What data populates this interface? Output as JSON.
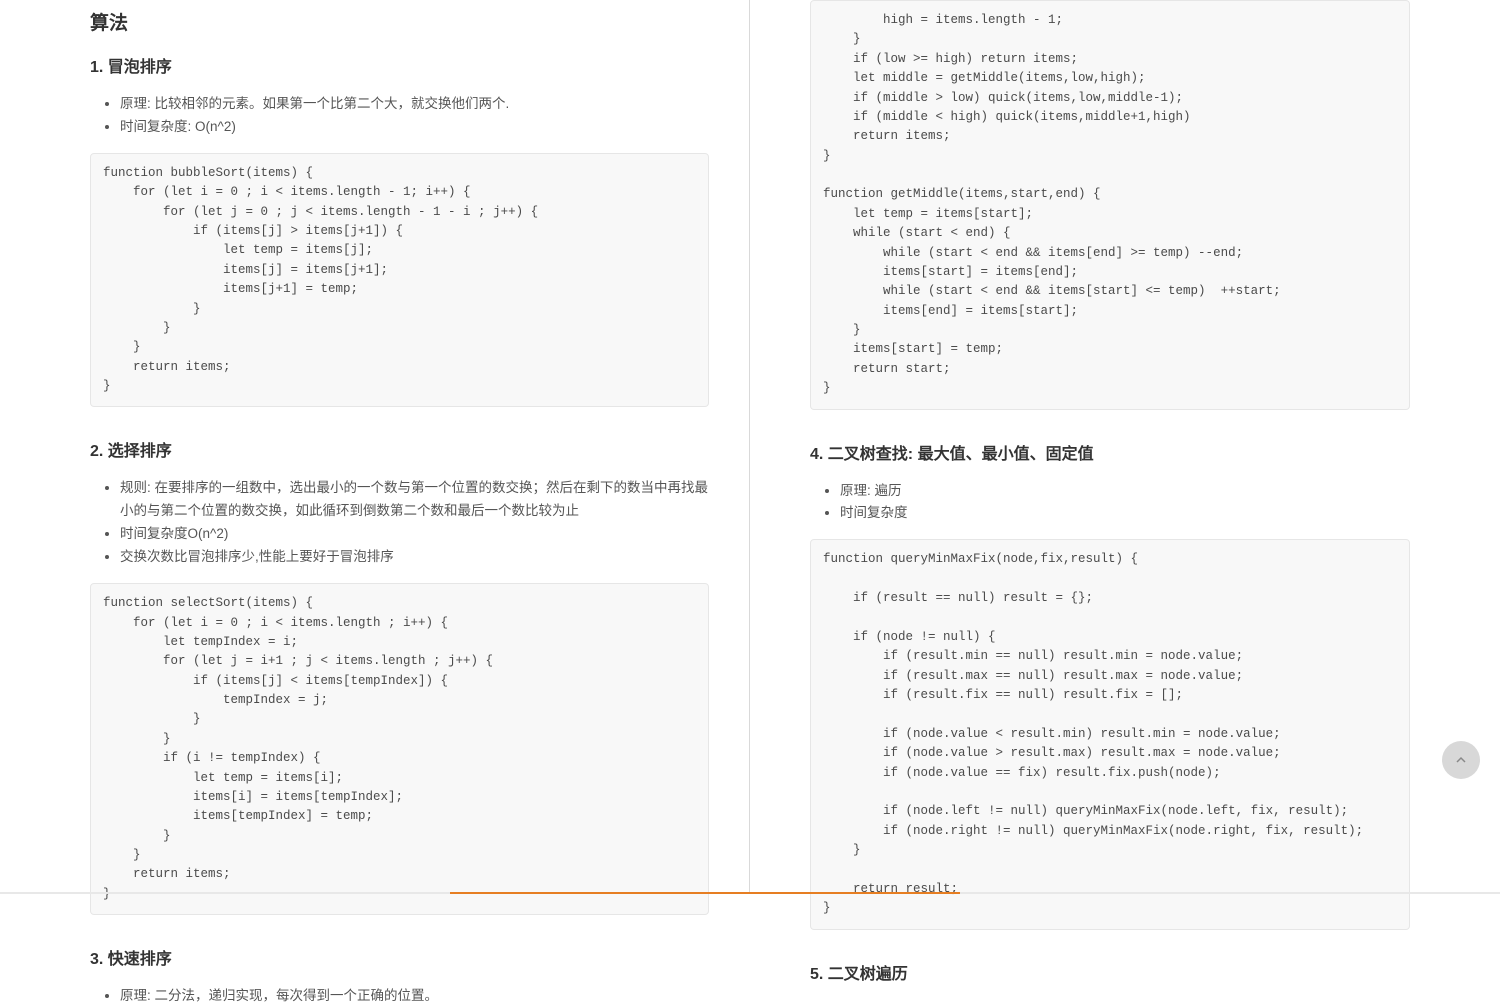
{
  "left": {
    "mainTitle": "算法",
    "s1": {
      "title": "1. 冒泡排序",
      "bullets": [
        "原理: 比较相邻的元素。如果第一个比第二个大，就交换他们两个.",
        "时间复杂度: O(n^2)"
      ],
      "code": "function bubbleSort(items) {\n    for (let i = 0 ; i < items.length - 1; i++) {\n        for (let j = 0 ; j < items.length - 1 - i ; j++) {\n            if (items[j] > items[j+1]) {\n                let temp = items[j];\n                items[j] = items[j+1];\n                items[j+1] = temp;\n            }\n        }\n    }\n    return items;\n}"
    },
    "s2": {
      "title": "2. 选择排序",
      "bullets": [
        "规则: 在要排序的一组数中，选出最小的一个数与第一个位置的数交换；然后在剩下的数当中再找最小的与第二个位置的数交换，如此循环到倒数第二个数和最后一个数比较为止",
        "时间复杂度O(n^2)",
        "交换次数比冒泡排序少,性能上要好于冒泡排序"
      ],
      "code": "function selectSort(items) {\n    for (let i = 0 ; i < items.length ; i++) {\n        let tempIndex = i;\n        for (let j = i+1 ; j < items.length ; j++) {\n            if (items[j] < items[tempIndex]) {\n                tempIndex = j;\n            }\n        }\n        if (i != tempIndex) {\n            let temp = items[i];\n            items[i] = items[tempIndex];\n            items[tempIndex] = temp;\n        }\n    }\n    return items;\n}"
    },
    "s3": {
      "title": "3. 快速排序",
      "bullets": [
        "原理: 二分法，递归实现，每次得到一个正确的位置。"
      ]
    }
  },
  "right": {
    "codeTop": "        high = items.length - 1;\n    }\n    if (low >= high) return items;\n    let middle = getMiddle(items,low,high);\n    if (middle > low) quick(items,low,middle-1);\n    if (middle < high) quick(items,middle+1,high)\n    return items;\n}\n\nfunction getMiddle(items,start,end) {\n    let temp = items[start];\n    while (start < end) {\n        while (start < end && items[end] >= temp) --end;\n        items[start] = items[end];\n        while (start < end && items[start] <= temp)  ++start;\n        items[end] = items[start];\n    }\n    items[start] = temp;\n    return start;\n}",
    "s4": {
      "title": "4. 二叉树查找: 最大值、最小值、固定值",
      "bullets": [
        "原理: 遍历",
        "时间复杂度"
      ],
      "code": "function queryMinMaxFix(node,fix,result) {\n\n    if (result == null) result = {};\n\n    if (node != null) {\n        if (result.min == null) result.min = node.value;\n        if (result.max == null) result.max = node.value;\n        if (result.fix == null) result.fix = [];\n\n        if (node.value < result.min) result.min = node.value;\n        if (node.value > result.max) result.max = node.value;\n        if (node.value == fix) result.fix.push(node);\n\n        if (node.left != null) queryMinMaxFix(node.left, fix, result);\n        if (node.right != null) queryMinMaxFix(node.right, fix, result);\n    }\n\n    return result;\n}"
    },
    "s5": {
      "title": "5. 二叉树遍历"
    }
  }
}
